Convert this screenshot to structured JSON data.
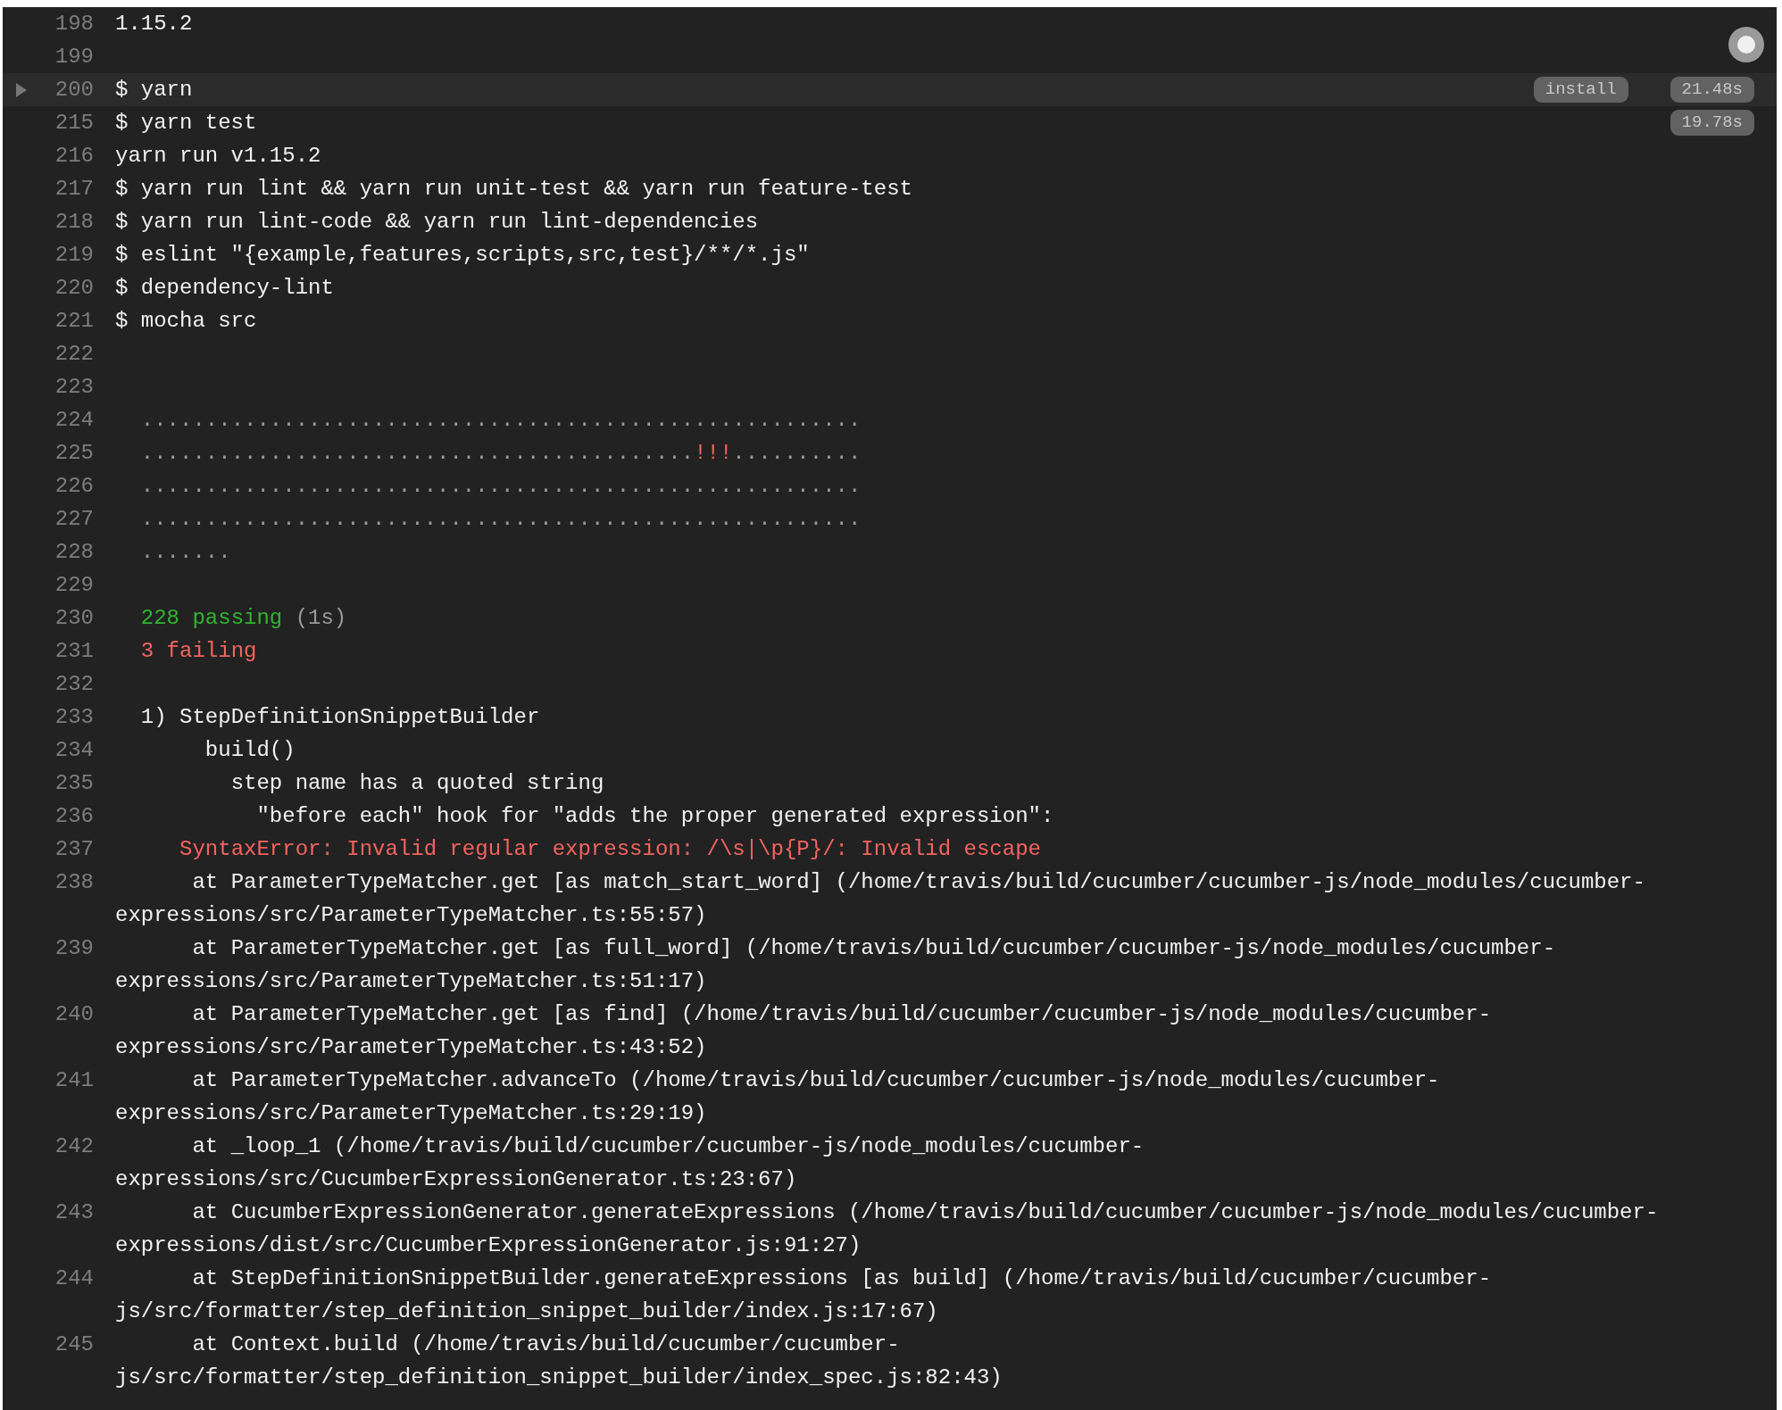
{
  "log": {
    "lines": [
      {
        "number": "198",
        "text": "1.15.2"
      },
      {
        "number": "199"
      },
      {
        "number": "200",
        "text": "$ yarn",
        "fold": {
          "expanded": false
        },
        "tag": "install",
        "duration": "21.48s"
      },
      {
        "number": "215",
        "text": "$ yarn test",
        "duration": "19.78s"
      },
      {
        "number": "216",
        "text": "yarn run v1.15.2"
      },
      {
        "number": "217",
        "text": "$ yarn run lint && yarn run unit-test && yarn run feature-test"
      },
      {
        "number": "218",
        "text": "$ yarn run lint-code && yarn run lint-dependencies"
      },
      {
        "number": "219",
        "text": "$ eslint \"{example,features,scripts,src,test}/**/*.js\""
      },
      {
        "number": "220",
        "text": "$ dependency-lint"
      },
      {
        "number": "221",
        "text": "$ mocha src"
      },
      {
        "number": "222"
      },
      {
        "number": "223"
      },
      {
        "number": "224",
        "segments": [
          {
            "text": "  ........................................................",
            "kind": "dim"
          }
        ]
      },
      {
        "number": "225",
        "segments": [
          {
            "text": "  ...........................................",
            "kind": "dim"
          },
          {
            "text": "!!!",
            "kind": "fail"
          },
          {
            "text": "..........",
            "kind": "dim"
          }
        ]
      },
      {
        "number": "226",
        "segments": [
          {
            "text": "  ........................................................",
            "kind": "dim"
          }
        ]
      },
      {
        "number": "227",
        "segments": [
          {
            "text": "  ........................................................",
            "kind": "dim"
          }
        ]
      },
      {
        "number": "228",
        "segments": [
          {
            "text": "  .......",
            "kind": "dim"
          }
        ]
      },
      {
        "number": "229"
      },
      {
        "number": "230",
        "segments": [
          {
            "text": "  228 passing",
            "kind": "pass"
          },
          {
            "text": " (1s)",
            "kind": "dim"
          }
        ]
      },
      {
        "number": "231",
        "segments": [
          {
            "text": "  3 failing",
            "kind": "fail"
          }
        ]
      },
      {
        "number": "232"
      },
      {
        "number": "233",
        "text": "  1) StepDefinitionSnippetBuilder"
      },
      {
        "number": "234",
        "text": "       build()"
      },
      {
        "number": "235",
        "text": "         step name has a quoted string"
      },
      {
        "number": "236",
        "text": "           \"before each\" hook for \"adds the proper generated expression\":"
      },
      {
        "number": "237",
        "segments": [
          {
            "text": "     SyntaxError: Invalid regular expression: /\\s|\\p{P}/: Invalid escape",
            "kind": "fail"
          }
        ]
      },
      {
        "number": "238",
        "text": "      at ParameterTypeMatcher.get [as match_start_word] (/home/travis/build/cucumber/cucumber-js/node_modules/cucumber-expressions/src/ParameterTypeMatcher.ts:55:57)"
      },
      {
        "number": "239",
        "text": "      at ParameterTypeMatcher.get [as full_word] (/home/travis/build/cucumber/cucumber-js/node_modules/cucumber-expressions/src/ParameterTypeMatcher.ts:51:17)"
      },
      {
        "number": "240",
        "text": "      at ParameterTypeMatcher.get [as find] (/home/travis/build/cucumber/cucumber-js/node_modules/cucumber-expressions/src/ParameterTypeMatcher.ts:43:52)"
      },
      {
        "number": "241",
        "text": "      at ParameterTypeMatcher.advanceTo (/home/travis/build/cucumber/cucumber-js/node_modules/cucumber-expressions/src/ParameterTypeMatcher.ts:29:19)"
      },
      {
        "number": "242",
        "text": "      at _loop_1 (/home/travis/build/cucumber/cucumber-js/node_modules/cucumber-expressions/src/CucumberExpressionGenerator.ts:23:67)"
      },
      {
        "number": "243",
        "text": "      at CucumberExpressionGenerator.generateExpressions (/home/travis/build/cucumber/cucumber-js/node_modules/cucumber-expressions/dist/src/CucumberExpressionGenerator.js:91:27)"
      },
      {
        "number": "244",
        "text": "      at StepDefinitionSnippetBuilder.generateExpressions [as build] (/home/travis/build/cucumber/cucumber-js/src/formatter/step_definition_snippet_builder/index.js:17:67)"
      },
      {
        "number": "245",
        "text": "      at Context.build (/home/travis/build/cucumber/cucumber-js/src/formatter/step_definition_snippet_builder/index_spec.js:82:43)"
      }
    ]
  }
}
